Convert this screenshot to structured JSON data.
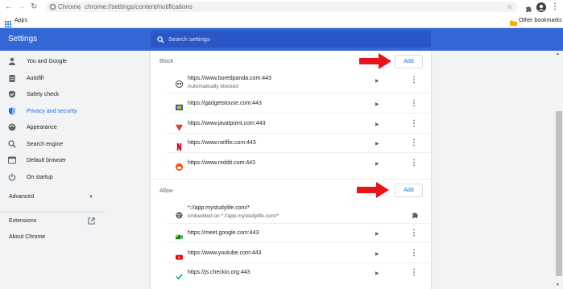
{
  "browser": {
    "brand": "Chrome",
    "url": "chrome://settings/content/notifications",
    "bookmarks_apps": "Apps",
    "other_bookmarks": "Other bookmarks"
  },
  "header": {
    "title": "Settings",
    "search_placeholder": "Search settings"
  },
  "sidebar": {
    "items": [
      {
        "label": "You and Google",
        "icon": "person-icon"
      },
      {
        "label": "Autofill",
        "icon": "clipboard-icon"
      },
      {
        "label": "Safety check",
        "icon": "shield-check-icon"
      },
      {
        "label": "Privacy and security",
        "icon": "shield-icon",
        "active": true
      },
      {
        "label": "Appearance",
        "icon": "palette-icon"
      },
      {
        "label": "Search engine",
        "icon": "search-icon"
      },
      {
        "label": "Default browser",
        "icon": "browser-icon"
      },
      {
        "label": "On startup",
        "icon": "power-icon"
      }
    ],
    "advanced": "Advanced",
    "extensions": "Extensions",
    "about": "About Chrome"
  },
  "block": {
    "label": "Block",
    "add_label": "Add",
    "sites": [
      {
        "url": "https://www.boredpanda.com:443",
        "sub": "Automatically blocked",
        "favicon": "boredpanda-icon"
      },
      {
        "url": "https://gadgetstouse.com:443",
        "favicon": "gadgetstouse-icon"
      },
      {
        "url": "https://www.javatpoint.com:443",
        "favicon": "javatpoint-icon"
      },
      {
        "url": "https://www.netflix.com:443",
        "favicon": "netflix-icon"
      },
      {
        "url": "https://www.reddit.com:443",
        "favicon": "reddit-icon"
      }
    ]
  },
  "allow": {
    "label": "Allow",
    "add_label": "Add",
    "sites": [
      {
        "url": "*://app.mystudylife.com/*",
        "sub": "embedded on *://app.mystudylife.com/*",
        "favicon": "globe-icon"
      },
      {
        "url": "https://meet.google.com:443",
        "favicon": "google-meet-icon"
      },
      {
        "url": "https://www.youtube.com:443",
        "favicon": "youtube-icon"
      },
      {
        "url": "https://js.checkio.org:443",
        "favicon": "checkio-icon"
      }
    ]
  },
  "colors": {
    "header": "#3367d6",
    "accent": "#1a73e8",
    "annotation_arrow": "#e8141b"
  }
}
